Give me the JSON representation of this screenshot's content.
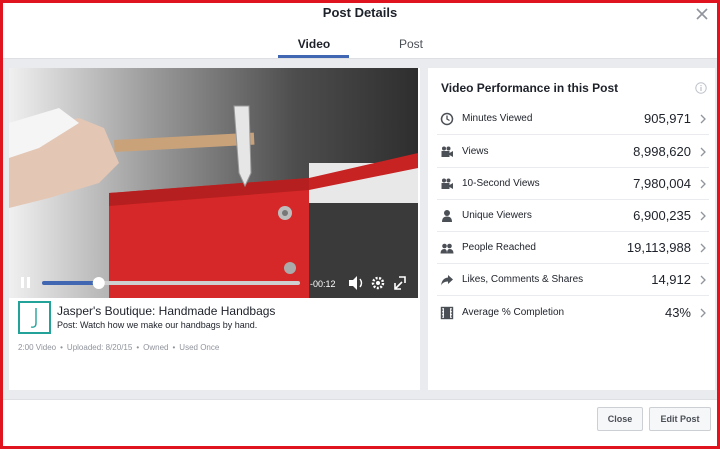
{
  "dialog": {
    "title": "Post Details"
  },
  "tabs": [
    {
      "label": "Video",
      "active": true
    },
    {
      "label": "Post",
      "active": false
    }
  ],
  "player": {
    "time_remaining": "-00:12",
    "progress_fraction": 0.22
  },
  "post": {
    "title": "Jasper's Boutique: Handmade Handbags",
    "description": "Post: Watch how we make our handbags by hand.",
    "meta": [
      "2:00 Video",
      "Uploaded: 8/20/15",
      "Owned",
      "Used Once"
    ]
  },
  "performance": {
    "title": "Video Performance in this Post",
    "metrics": [
      {
        "icon": "clock-icon",
        "label": "Minutes Viewed",
        "value": "905,971"
      },
      {
        "icon": "video-camera-icon",
        "label": "Views",
        "value": "8,998,620"
      },
      {
        "icon": "video-camera-icon",
        "label": "10-Second Views",
        "value": "7,980,004"
      },
      {
        "icon": "person-icon",
        "label": "Unique Viewers",
        "value": "6,900,235"
      },
      {
        "icon": "people-icon",
        "label": "People Reached",
        "value": "19,113,988"
      },
      {
        "icon": "share-arrow-icon",
        "label": "Likes, Comments & Shares",
        "value": "14,912"
      },
      {
        "icon": "film-icon",
        "label": "Average % Completion",
        "value": "43%"
      }
    ]
  },
  "footer": {
    "close_label": "Close",
    "edit_label": "Edit Post"
  },
  "colors": {
    "accent": "#4267b2",
    "frame": "#e0141e",
    "logo": "#23a29a",
    "bag": "#d62828"
  }
}
